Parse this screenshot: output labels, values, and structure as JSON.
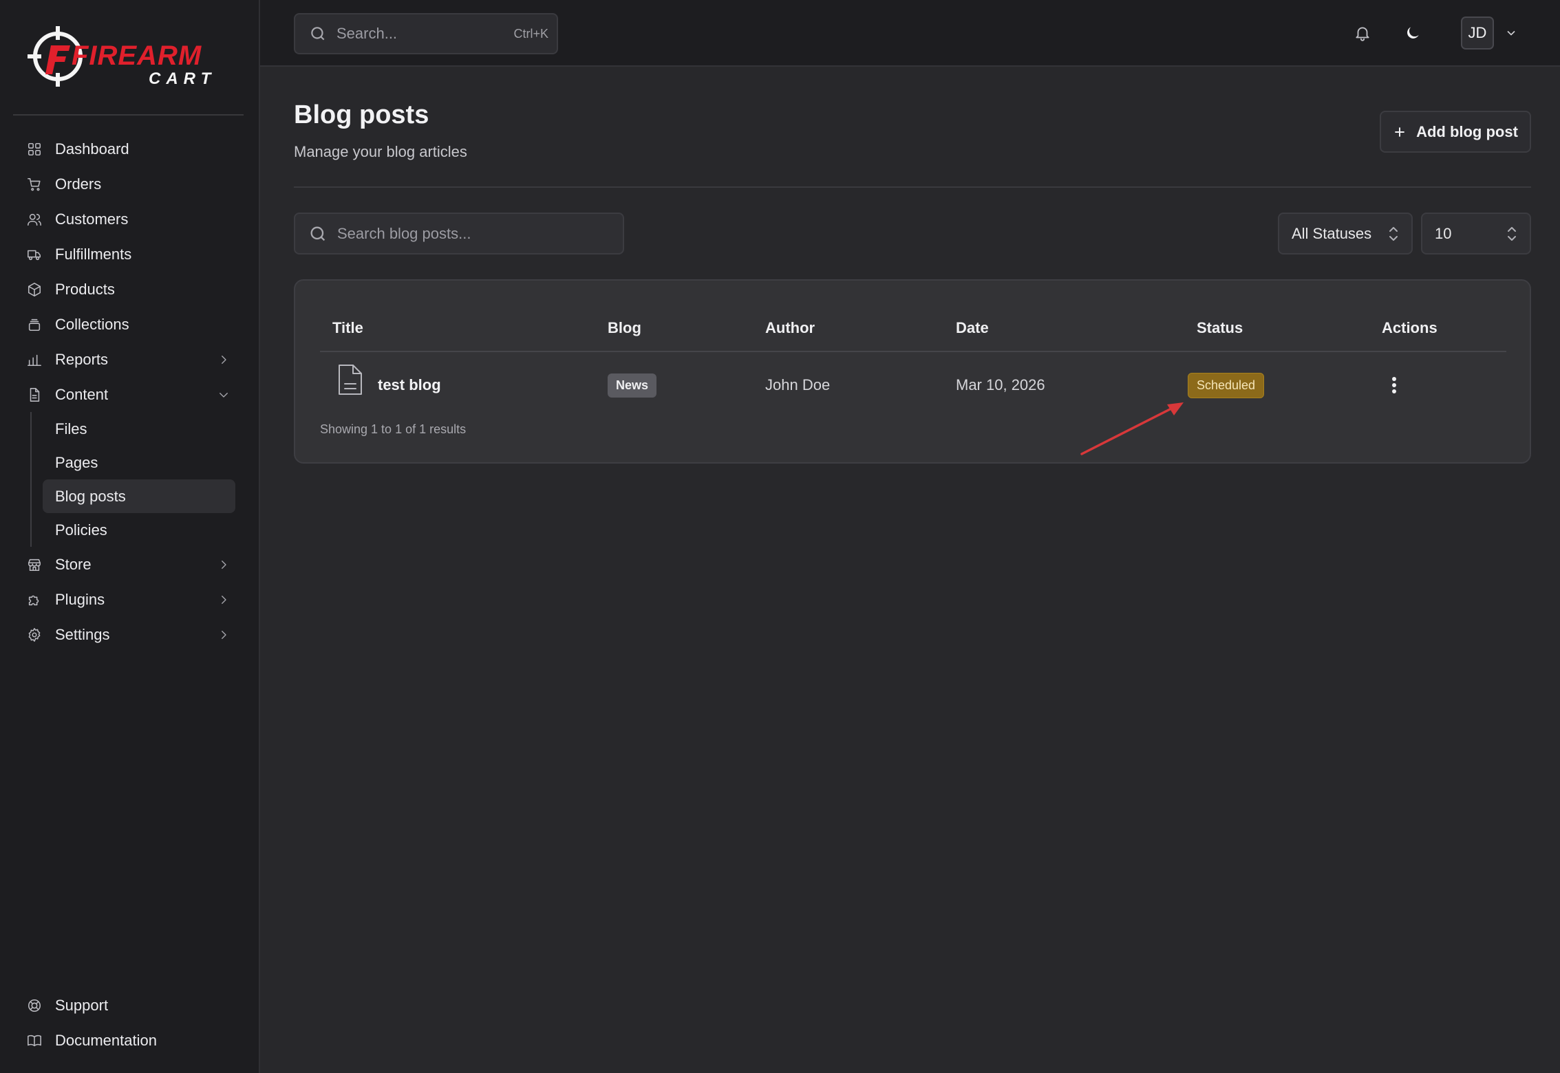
{
  "brand": {
    "logo_text_main": "FIREARM",
    "logo_text_sub": "CART",
    "accent": "#e0202c"
  },
  "sidebar": {
    "items": [
      {
        "label": "Dashboard",
        "icon": "grid-icon"
      },
      {
        "label": "Orders",
        "icon": "cart-icon"
      },
      {
        "label": "Customers",
        "icon": "users-icon"
      },
      {
        "label": "Fulfillments",
        "icon": "truck-icon"
      },
      {
        "label": "Products",
        "icon": "box-icon"
      },
      {
        "label": "Collections",
        "icon": "layers-icon"
      },
      {
        "label": "Reports",
        "icon": "bar-chart-icon"
      },
      {
        "label": "Content",
        "icon": "document-icon"
      }
    ],
    "content_subitems": [
      "Files",
      "Pages",
      "Blog posts",
      "Policies"
    ],
    "items_after": [
      {
        "label": "Store",
        "icon": "store-icon"
      },
      {
        "label": "Plugins",
        "icon": "puzzle-icon"
      },
      {
        "label": "Settings",
        "icon": "gear-icon"
      }
    ],
    "bottom": [
      {
        "label": "Support",
        "icon": "lifebuoy-icon"
      },
      {
        "label": "Documentation",
        "icon": "book-icon"
      }
    ]
  },
  "header": {
    "search_placeholder": "Search...",
    "search_shortcut": "Ctrl+K",
    "avatar_initials": "JD"
  },
  "page": {
    "title": "Blog posts",
    "subtitle": "Manage your blog articles",
    "add_button": "Add blog post",
    "search_placeholder": "Search blog posts...",
    "status_filter": "All Statuses",
    "page_size": "10"
  },
  "table": {
    "columns": [
      "Title",
      "Blog",
      "Author",
      "Date",
      "Status",
      "Actions"
    ],
    "rows": [
      {
        "title": "test blog",
        "blog": "News",
        "author": "John Doe",
        "date": "Mar 10, 2026",
        "status": "Scheduled"
      }
    ],
    "results_text": "Showing 1 to 1 of 1 results"
  },
  "colors": {
    "status_scheduled_bg": "#8c6a1a",
    "annotation_arrow": "#d8383a"
  }
}
